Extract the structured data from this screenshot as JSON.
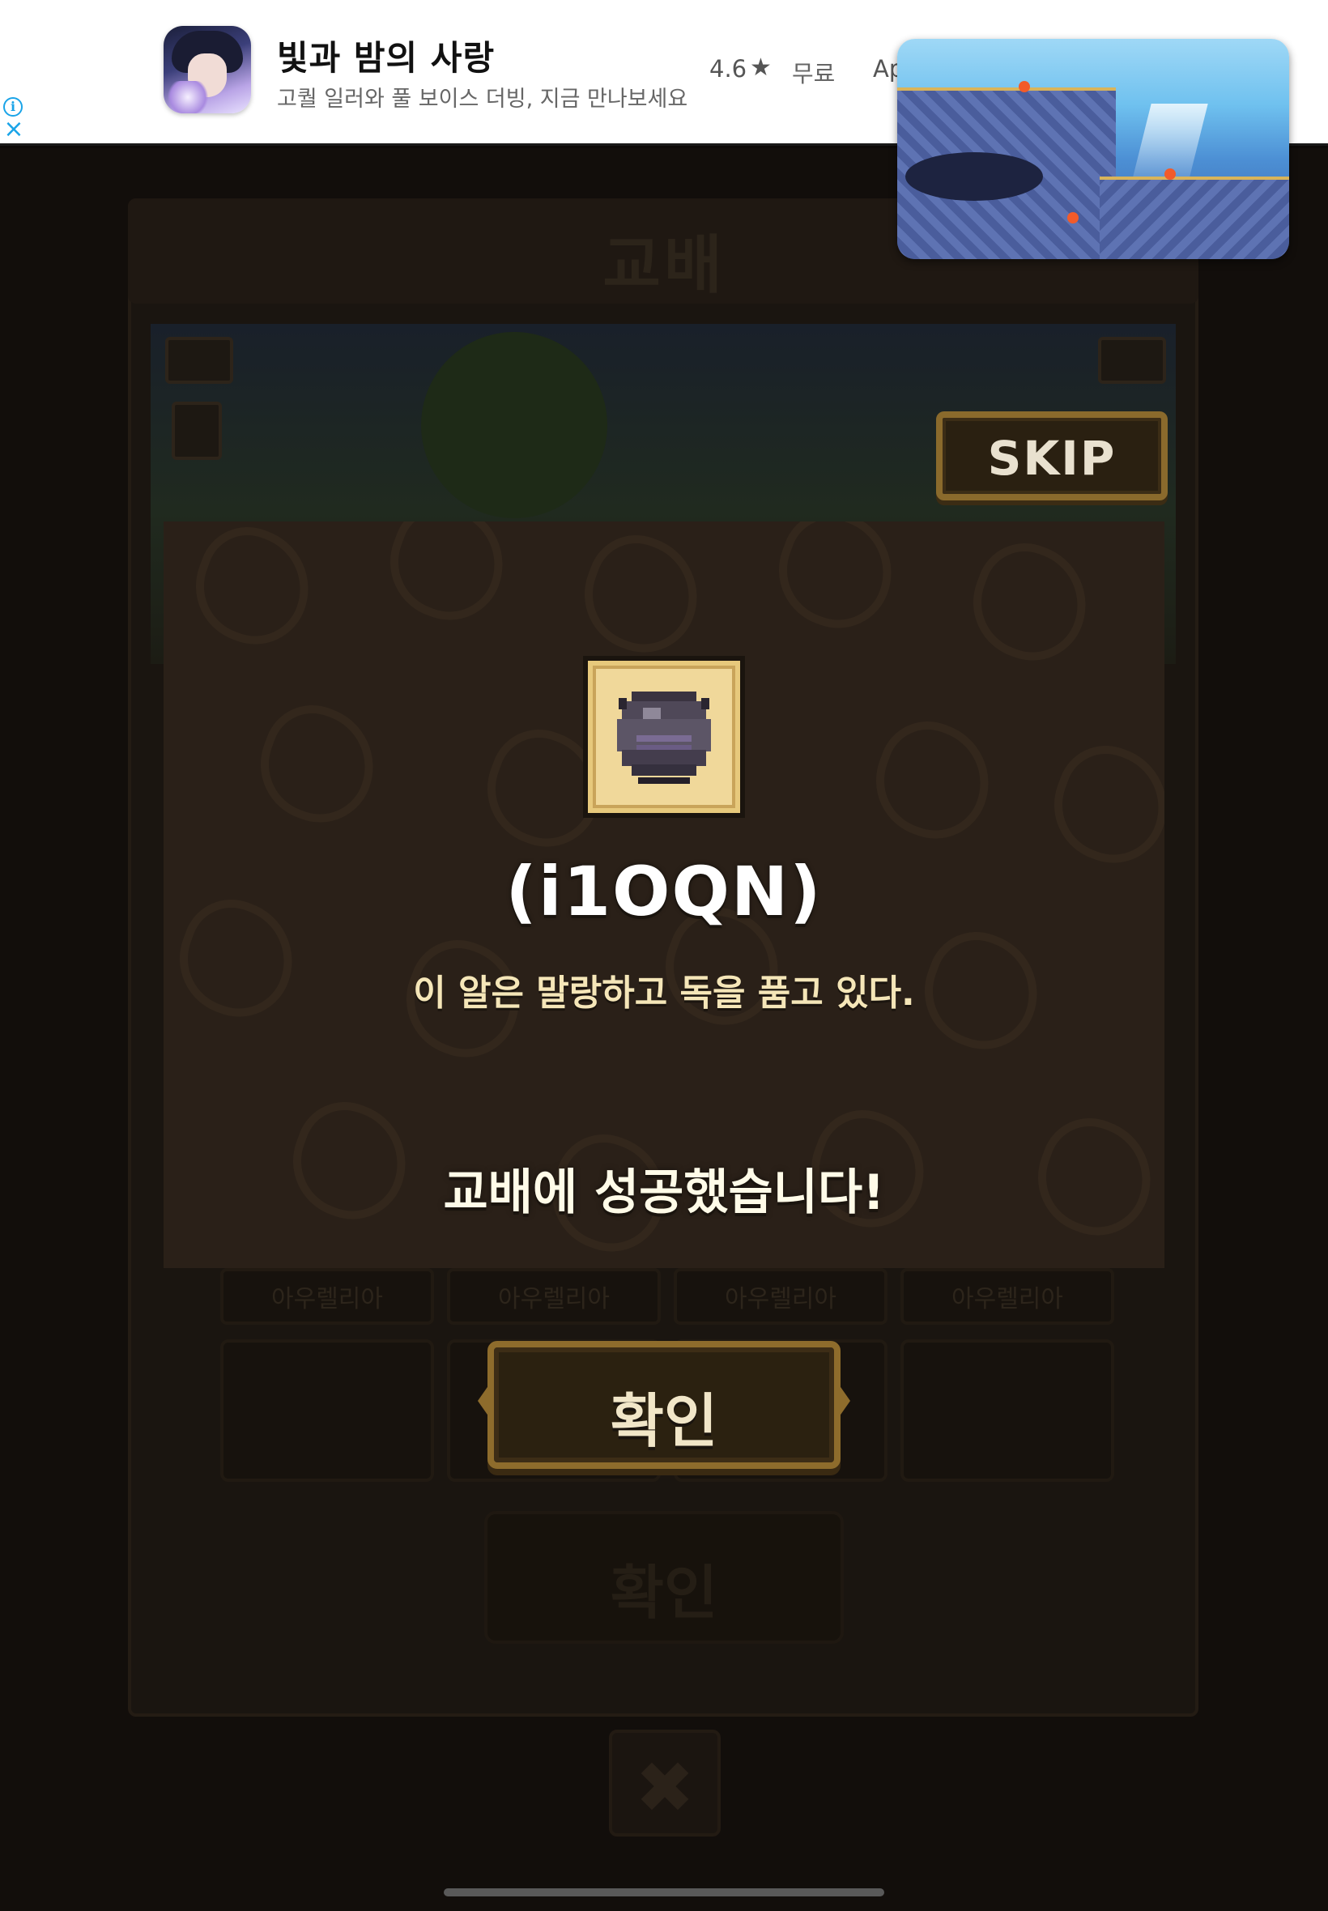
{
  "ad": {
    "title": "빛과 밤의 사랑",
    "subtitle": "고퀄 일러와 풀 보이스 더빙, 지금 만나보세요",
    "rating": "4.6",
    "star_icon": "star-icon",
    "price": "무료",
    "store": "Ap",
    "info_icon": "i",
    "close_icon": "×"
  },
  "background": {
    "title": "교배",
    "skip_label": "SKIP",
    "card_labels": [
      "아우렐리아",
      "아우렐리아",
      "아우렐리아",
      "아우렐리아"
    ],
    "confirm_label": "확인",
    "close_icon": "✖"
  },
  "modal": {
    "item_icon": "dark-egg-icon",
    "item_name": "(i1OQN)",
    "item_description": "이 알은 말랑하고 독을 품고 있다.",
    "result_message": "교배에 성공했습니다!"
  },
  "confirm": {
    "label": "확인"
  },
  "colors": {
    "modal_bg": "#2a2018",
    "button_border": "#8e6c2c",
    "ad_accent": "#1aa4e8",
    "item_frame": "#f0d89a"
  }
}
